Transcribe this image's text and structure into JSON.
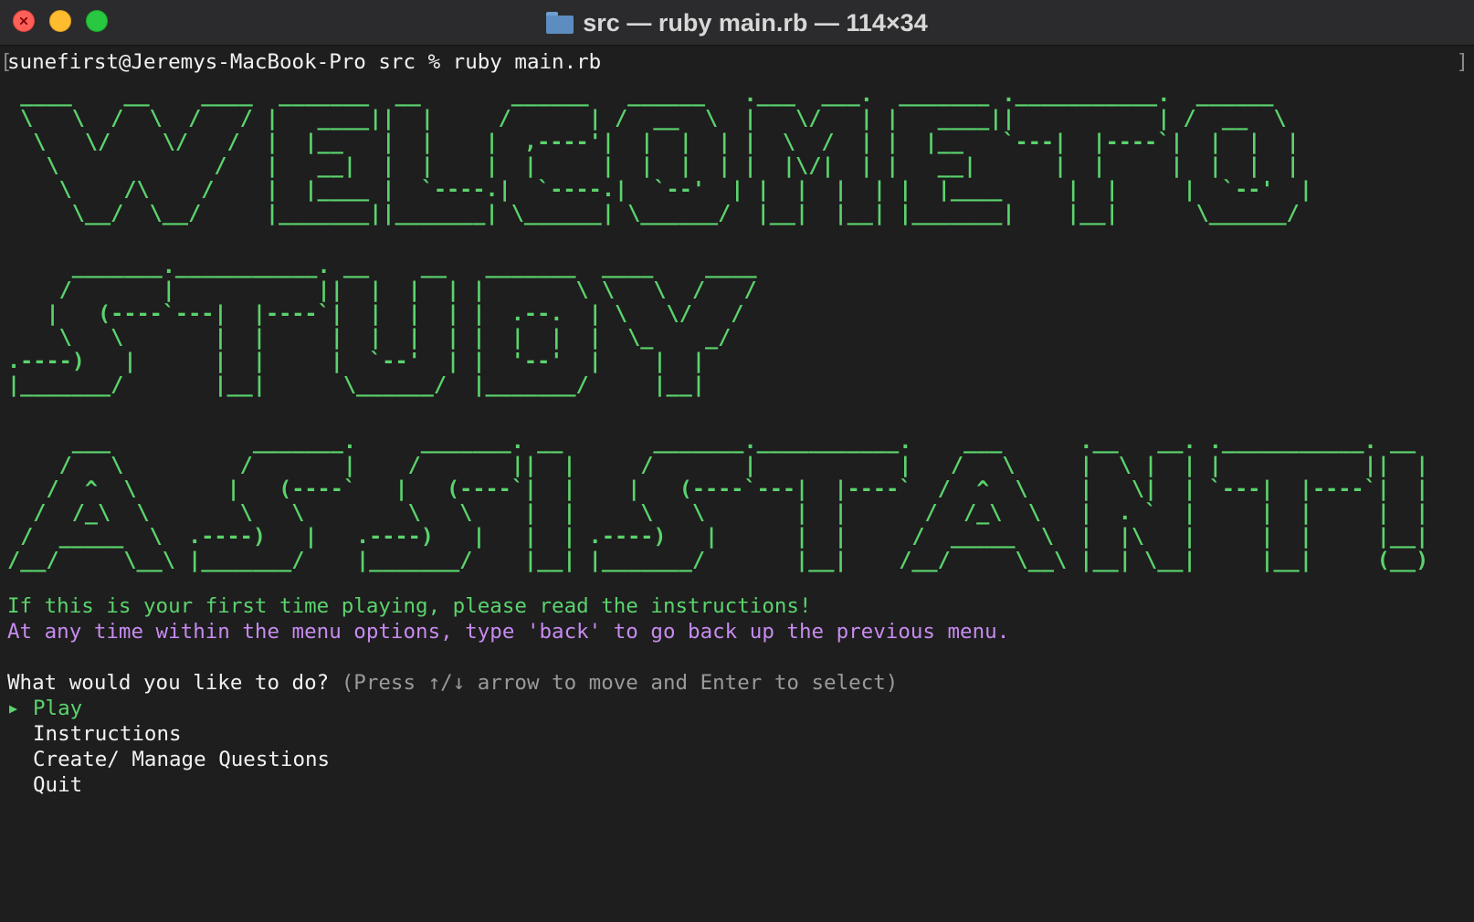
{
  "window": {
    "title": "src — ruby main.rb — 114×34",
    "icon": "folder-icon"
  },
  "terminal": {
    "prompt": "sunefirst@Jeremys-MacBook-Pro src % ruby main.rb",
    "banner": {
      "art1": " ____    __    ____  _______  __       ______   ______   .___  ___.  _______ .___________.  ______  \n \\   \\  /  \\  /   / |   ____||  |     /      | /  __  \\  |   \\/   | |   ____||           | /  __  \\ \n  \\   \\/    \\/   /  |  |__   |  |    |  ,----'|  |  |  | |  \\  /  | |  |__   `---|  |----`|  |  |  |\n   \\            /   |   __|  |  |    |  |     |  |  |  | |  |\\/|  | |   __|      |  |     |  |  |  |\n    \\    /\\    /    |  |____ |  `----.|  `----.|  `--'  | |  |  |  | |  |____     |  |     |  `--'  |\n     \\__/  \\__/     |_______||_______| \\______| \\______/  |__|  |__| |_______|    |__|      \\______/ ",
      "art2": "     _______.___________. __    __   _______  ____    ____ \n    /       |           ||  |  |  | |       \\ \\   \\  /   / \n   |   (----`---|  |----`|  |  |  | |  .--.  | \\   \\/   /  \n    \\   \\       |  |     |  |  |  | |  |  |  |  \\_    _/   \n.----)   |      |  |     |  `--'  | |  '--'  |    |  |     \n|_______/       |__|      \\______/  |_______/     |__|     ",
      "art3": "     ___           _______.     _______. __       _______.___________.    ___      .__   __. .___________. __ \n    /   \\         /       |    /       ||  |     /       |           |   /   \\     |  \\ |  | |           ||  |\n   /  ^  \\       |   (----`   |   (----`|  |    |   (----`---|  |----`  /  ^  \\    |   \\|  | `---|  |----`|  |\n  /  /_\\  \\       \\   \\        \\   \\    |  |     \\   \\       |  |      /  /_\\  \\   |  . `  |     |  |     |  |\n /  _____  \\  .----)   |   .----)   |   |  | .----)   |      |  |     /  _____  \\  |  |\\   |     |  |     |__|\n/__/     \\__\\ |_______/    |_______/    |__| |_______/       |__|    /__/     \\__\\ |__| \\__|     |__|     (__)"
    },
    "notice_first_time": "If this is your first time playing, please read the instructions!",
    "notice_back": "At any time within the menu options, type 'back' to go back up the previous menu.",
    "question": "What would you like to do?",
    "hint": "(Press ↑/↓ arrow to move and Enter to select)",
    "pointer": "▶",
    "menu": [
      {
        "label": "Play",
        "selected": true
      },
      {
        "label": "Instructions",
        "selected": false
      },
      {
        "label": "Create/ Manage Questions",
        "selected": false
      },
      {
        "label": "Quit",
        "selected": false
      }
    ]
  },
  "colors": {
    "background": "#1e1e1e",
    "green": "#5bd36d",
    "purple": "#c78bf0",
    "gray": "#9a9a9a"
  }
}
